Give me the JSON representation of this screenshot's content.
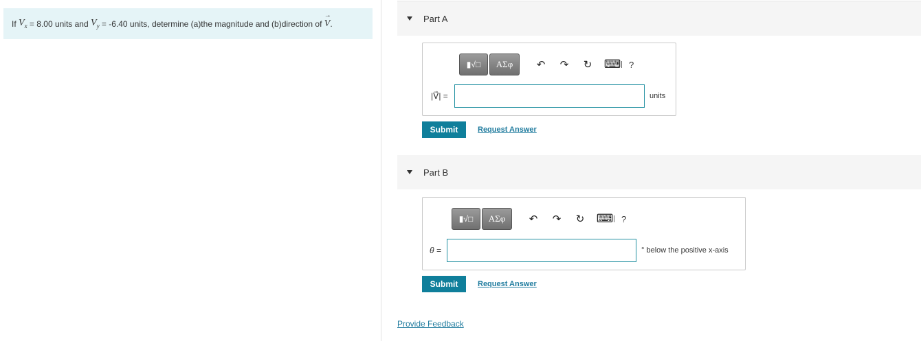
{
  "problem": {
    "prefix": "If",
    "vx_symbol": "V",
    "vx_sub": "x",
    "vx_text": "= 8.00 units and",
    "vy_symbol": "V",
    "vy_sub": "y",
    "vy_text": "= -6.40 units, determine (a)the magnitude and (b)direction of",
    "v_symbol": "V",
    "suffix": "."
  },
  "toolbar": {
    "templates_glyph": "▮√□",
    "symbols_label": "ΑΣφ",
    "undo_glyph": "↶",
    "redo_glyph": "↷",
    "reset_glyph": "↻",
    "keyboard_glyph": "⌨",
    "help_label": "?"
  },
  "part_a": {
    "title": "Part A",
    "var_label": "|V⃗| =",
    "input_value": "",
    "unit": "units",
    "submit_label": "Submit",
    "request_label": "Request Answer"
  },
  "part_b": {
    "title": "Part B",
    "var_label": "θ =",
    "input_value": "",
    "unit": "° below the positive x-axis",
    "submit_label": "Submit",
    "request_label": "Request Answer"
  },
  "feedback": {
    "label": "Provide Feedback"
  },
  "colors": {
    "accent": "#0f7f9b",
    "link": "#1f7b9e",
    "problem_bg": "#e5f4f7",
    "header_bg": "#f5f5f5"
  }
}
